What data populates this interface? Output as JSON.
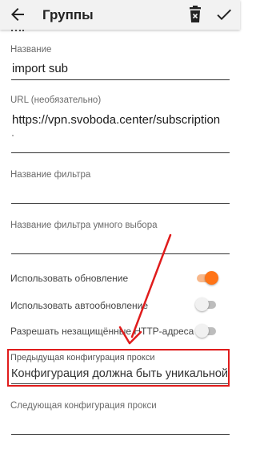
{
  "appbar": {
    "title": "Группы",
    "back_icon": "arrow-back-icon",
    "delete_icon": "delete-icon",
    "confirm_icon": "check-icon"
  },
  "fields": {
    "name": {
      "label": "Название",
      "value": "import sub"
    },
    "url": {
      "label": "URL (необязательно)",
      "value": "https://vpn.svoboda.center/subscription"
    },
    "filter_name": {
      "label": "Название фильтра",
      "value": ""
    },
    "smart_filter_name": {
      "label": "Название фильтра умного выбора",
      "value": ""
    },
    "prev_proxy": {
      "label": "Предыдущая конфигурация прокси",
      "value": "Конфигурация должна быть уникальной"
    },
    "next_proxy": {
      "label": "Следующая конфигурация прокси",
      "value": ""
    }
  },
  "switches": {
    "use_update": {
      "label": "Использовать обновление",
      "on": true
    },
    "auto_update": {
      "label": "Использовать автообновление",
      "on": false
    },
    "insecure_http": {
      "label": "Разрешать незащищённые HTTP-адреса",
      "on": false
    }
  },
  "colors": {
    "accent": "#ff7417",
    "annotation": "#e01c1c"
  }
}
